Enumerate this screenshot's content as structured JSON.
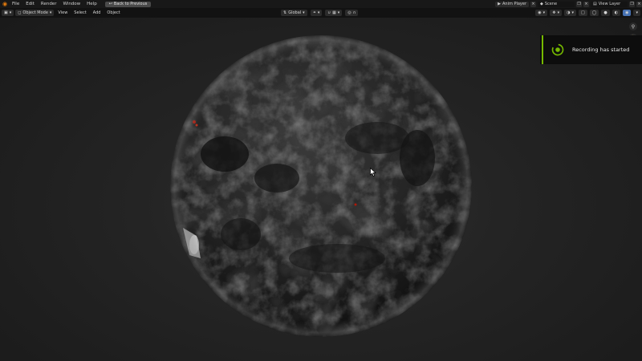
{
  "menu": {
    "items": [
      "File",
      "Edit",
      "Render",
      "Window",
      "Help"
    ],
    "back_button": "Back to Previous"
  },
  "topbar_right": {
    "anim_player": "Anim Player",
    "scene": "Scene",
    "view_layer": "View Layer"
  },
  "viewport_header": {
    "mode": "Object Mode",
    "menus": [
      "View",
      "Select",
      "Add",
      "Object"
    ],
    "transform_orientation": "Global"
  },
  "toast": {
    "message": "Recording has started",
    "accent_color": "#76b900"
  },
  "colors": {
    "blender_orange": "#e87d0d",
    "sphere_base": "#2a2a2a"
  }
}
